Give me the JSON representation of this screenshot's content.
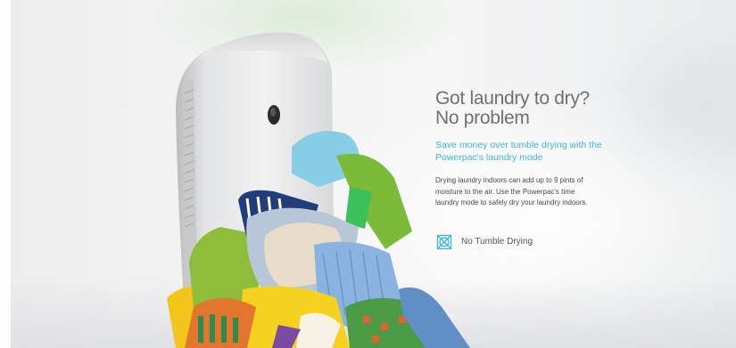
{
  "hero": {
    "headline_line1": "Got laundry to dry?",
    "headline_line2": "No problem",
    "subheadline": "Save money over tumble drying with the Powerpac's laundry mode",
    "body": "Drying laundry indoors can add up to 9 pints of moisture to the air. Use the Powerpac's time laundry mode to safely dry your laundry indoors.",
    "feature": {
      "icon": "no-tumble-drying-icon",
      "label": "No Tumble Drying"
    }
  },
  "colors": {
    "accent": "#3fb4d5",
    "headline": "#707070",
    "body": "#4a4a4a"
  }
}
